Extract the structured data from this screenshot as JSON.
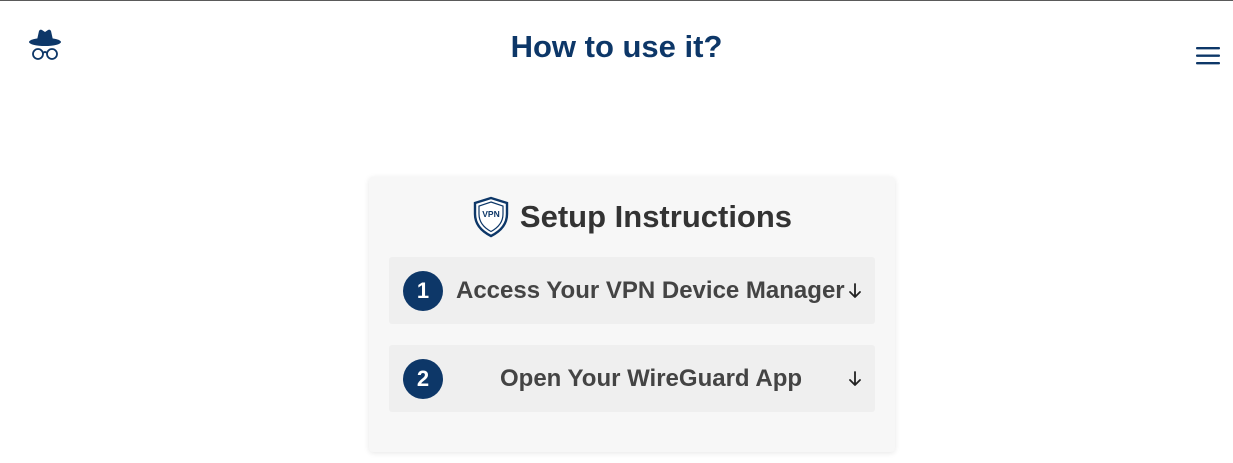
{
  "header": {
    "title": "How to use it?",
    "logo_icon": "incognito-hat-glasses-icon",
    "menu_icon": "hamburger-menu-icon"
  },
  "card": {
    "title": "Setup Instructions",
    "title_icon": "vpn-shield-icon",
    "title_icon_text": "VPN",
    "steps": [
      {
        "number": "1",
        "label": "Access Your VPN Device Manager",
        "arrow_icon": "arrow-down-icon"
      },
      {
        "number": "2",
        "label": "Open Your WireGuard App",
        "arrow_icon": "arrow-down-icon"
      }
    ]
  },
  "colors": {
    "brand_navy": "#0d3768",
    "card_bg": "#f7f7f7",
    "step_bg": "#efefef",
    "text_dark": "#333333"
  }
}
